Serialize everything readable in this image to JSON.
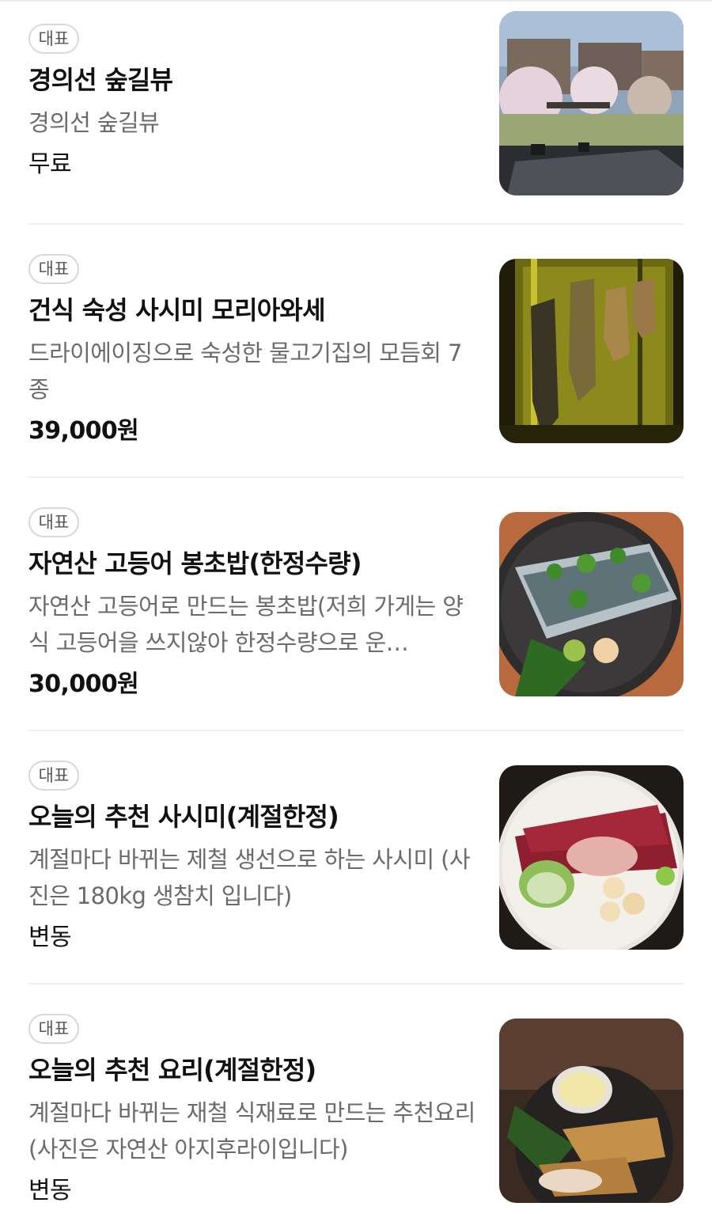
{
  "menu": {
    "items": [
      {
        "badge": "대표",
        "name": "경의선 숲길뷰",
        "description": "경의선 숲길뷰",
        "price": "무료",
        "photo_icon": "forest-terrace-photo"
      },
      {
        "badge": "대표",
        "name": "건식 숙성 사시미 모리아와세",
        "description": "드라이에이징으로 숙성한 물고기집의 모듬회 7종",
        "price": "39,000원",
        "photo_icon": "dry-aging-fish-photo"
      },
      {
        "badge": "대표",
        "name": "자연산 고등어 봉초밥(한정수량)",
        "description": "자연산 고등어로 만드는 봉초밥(저희 가게는 양식 고등어을 쓰지않아 한정수량으로 운…",
        "price": "30,000원",
        "photo_icon": "mackerel-sushi-photo"
      },
      {
        "badge": "대표",
        "name": "오늘의 추천 사시미(계절한정)",
        "description": "계절마다 바뀌는 제철 생선으로 하는 사시미 (사진은 180kg 생참치 입니다)",
        "price": "변동",
        "photo_icon": "tuna-sashimi-photo"
      },
      {
        "badge": "대표",
        "name": "오늘의 추천 요리(계절한정)",
        "description": "계절마다 바뀌는 재철 식재료로 만드는 추천요리(사진은 자연산 아지후라이입니다)",
        "price": "변동",
        "photo_icon": "aji-fry-photo"
      }
    ]
  }
}
